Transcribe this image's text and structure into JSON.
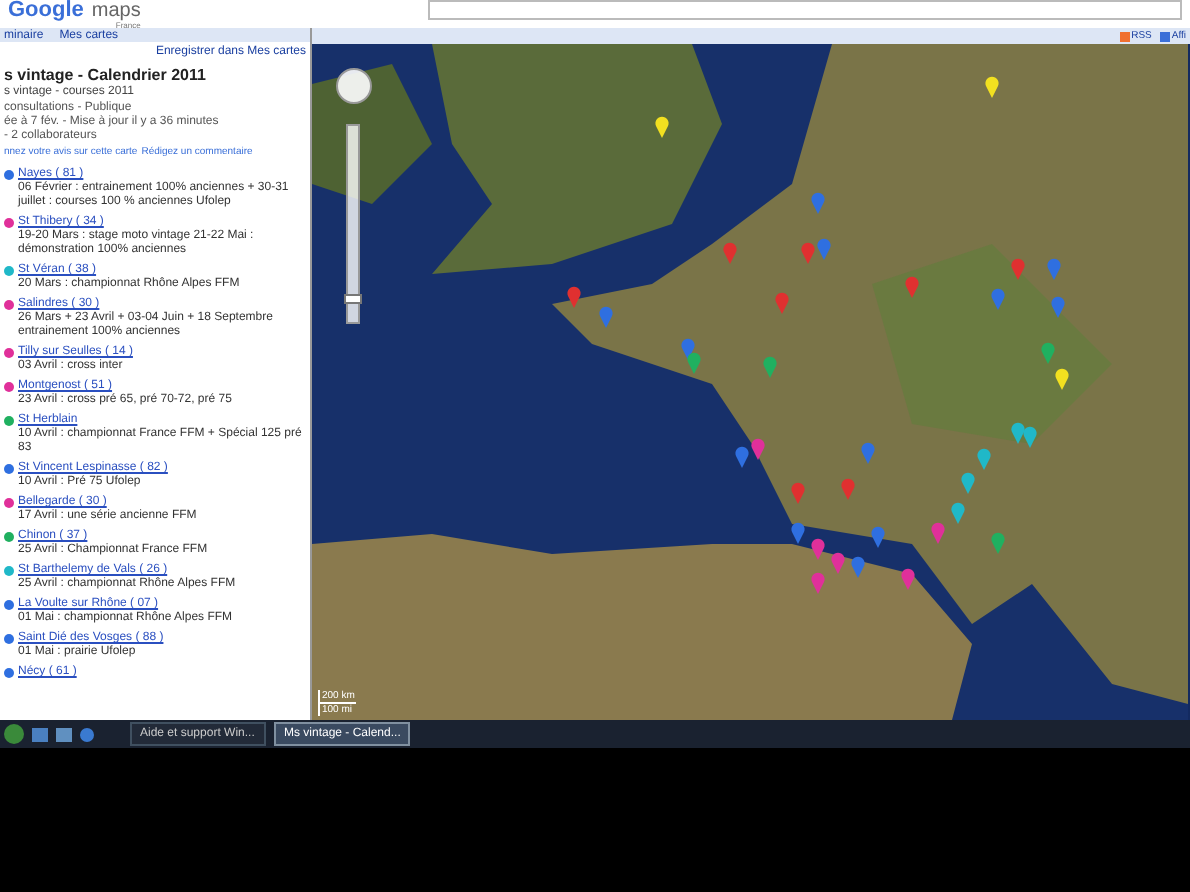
{
  "header": {
    "logo_word": "Google",
    "logo_product": "maps",
    "logo_region": "France"
  },
  "sidebar": {
    "nav": [
      "minaire",
      "Mes cartes"
    ],
    "save_link": "Enregistrer dans Mes cartes",
    "title": "s vintage - Calendrier 2011",
    "subtitle": "s vintage - courses 2011",
    "meta": [
      "consultations - Publique",
      "ée à 7 fév. - Mise à jour il y a 36 minutes",
      "- 2 collaborateurs"
    ],
    "feedback": "nnez votre avis sur cette carte",
    "comment_link": "Rédigez un commentaire",
    "items": [
      {
        "name": "Nayes ( 81 )",
        "text": "06 Février : entrainement 100% anciennes + 30-31 juillet : courses 100 % anciennes Ufolep",
        "color": "#2f6fe0"
      },
      {
        "name": "St Thibery ( 34 )",
        "text": "19-20 Mars : stage moto vintage 21-22 Mai : démonstration 100% anciennes",
        "color": "#e0309a"
      },
      {
        "name": "St Véran ( 38 )",
        "text": "20 Mars : championnat Rhône Alpes FFM",
        "color": "#20b8c8"
      },
      {
        "name": "Salindres ( 30 )",
        "text": "26 Mars + 23 Avril + 03-04 Juin + 18 Septembre entrainement 100% anciennes",
        "color": "#e0309a"
      },
      {
        "name": "Tilly sur Seulles ( 14 )",
        "text": "03 Avril : cross inter",
        "color": "#e0309a"
      },
      {
        "name": "Montgenost ( 51 )",
        "text": "23 Avril : cross pré 65, pré 70-72, pré 75",
        "color": "#e0309a"
      },
      {
        "name": "St Herblain",
        "text": "10 Avril : championnat France FFM + Spécial 125 pré 83",
        "color": "#20b060"
      },
      {
        "name": "St Vincent Lespinasse ( 82 )",
        "text": "10 Avril : Pré 75 Ufolep",
        "color": "#2f6fe0"
      },
      {
        "name": "Bellegarde ( 30 )",
        "text": "17 Avril : une série ancienne FFM",
        "color": "#e0309a"
      },
      {
        "name": "Chinon ( 37 )",
        "text": "25 Avril : Championnat France FFM",
        "color": "#20b060"
      },
      {
        "name": "St Barthelemy de Vals ( 26 )",
        "text": "25 Avril : championnat Rhône Alpes FFM",
        "color": "#20b8c8"
      },
      {
        "name": "La Voulte sur Rhône ( 07 )",
        "text": "01 Mai : championnat Rhône Alpes FFM",
        "color": "#2f6fe0"
      },
      {
        "name": "Saint Dié des Vosges ( 88 )",
        "text": "01 Mai : prairie Ufolep",
        "color": "#2f6fe0"
      },
      {
        "name": "Nécy ( 61 )",
        "color": "#2f6fe0"
      }
    ]
  },
  "map": {
    "toolbar": [
      "RSS",
      "Affi"
    ],
    "zoom": {
      "level": 0.1
    },
    "scale": [
      "200 km",
      "100 mi"
    ]
  },
  "taskbar": {
    "windows": [
      {
        "label": "Aide et support Win...",
        "selected": false
      },
      {
        "label": "Ms vintage - Calend...",
        "selected": true
      }
    ]
  }
}
